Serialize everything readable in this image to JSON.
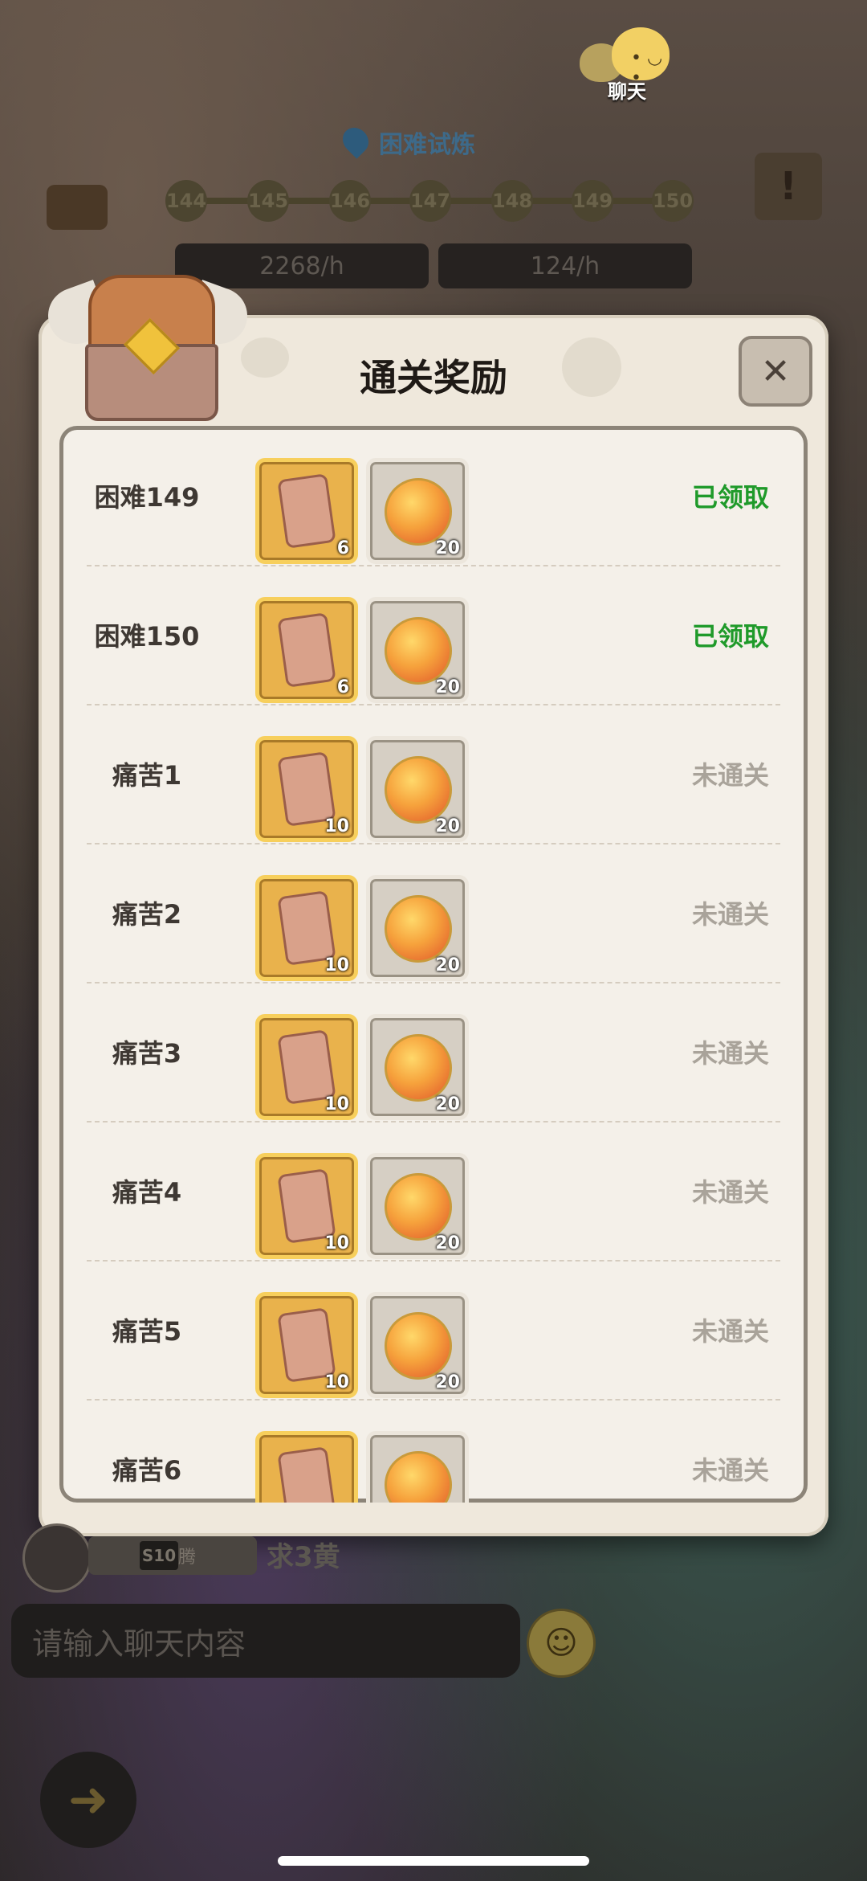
{
  "chat_top": {
    "label": "聊天",
    "icon": "chat-bubble-icon"
  },
  "stage_header": {
    "title": "困难试炼",
    "nodes": [
      "144",
      "145",
      "146",
      "147",
      "148",
      "149",
      "150"
    ],
    "resources": [
      {
        "icon": "coin-icon",
        "value": "2268/h"
      },
      {
        "icon": "exp-icon",
        "value": "124/h"
      }
    ]
  },
  "modal": {
    "title": "通关奖励",
    "close_label": "✕",
    "rows": [
      {
        "label": "困难149",
        "scroll_qty": "6",
        "orb_qty": "20",
        "status": "已领取",
        "status_type": "claimed"
      },
      {
        "label": "困难150",
        "scroll_qty": "6",
        "orb_qty": "20",
        "status": "已领取",
        "status_type": "claimed"
      },
      {
        "label": "痛苦1",
        "scroll_qty": "10",
        "orb_qty": "20",
        "status": "未通关",
        "status_type": "locked"
      },
      {
        "label": "痛苦2",
        "scroll_qty": "10",
        "orb_qty": "20",
        "status": "未通关",
        "status_type": "locked"
      },
      {
        "label": "痛苦3",
        "scroll_qty": "10",
        "orb_qty": "20",
        "status": "未通关",
        "status_type": "locked"
      },
      {
        "label": "痛苦4",
        "scroll_qty": "10",
        "orb_qty": "20",
        "status": "未通关",
        "status_type": "locked"
      },
      {
        "label": "痛苦5",
        "scroll_qty": "10",
        "orb_qty": "20",
        "status": "未通关",
        "status_type": "locked"
      },
      {
        "label": "痛苦6",
        "scroll_qty": "",
        "orb_qty": "",
        "status": "未通关",
        "status_type": "locked"
      }
    ]
  },
  "chat": {
    "vip": "S10",
    "name": "魔腾",
    "message": "求3黄",
    "input_placeholder": "请输入聊天内容"
  },
  "colors": {
    "claimed": "#1f9a2a",
    "locked": "#a9a39a",
    "modal_bg": "#efe8dc"
  }
}
